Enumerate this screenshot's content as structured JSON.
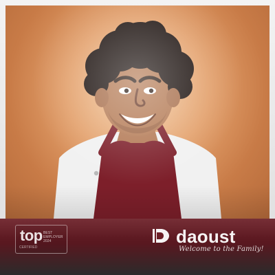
{
  "hero": {
    "image_label": "smiling-man-in-apron"
  },
  "badge": {
    "top_text": "top",
    "right_text": "BEST EMPLOYER 2024",
    "bottom_text": "CERTIFIED"
  },
  "brand": {
    "name": "daoust",
    "tagline": "Welcome to the Family!"
  },
  "colors": {
    "background": "#e9e9e9",
    "orange_bg": "#d98d56",
    "apron_red": "#7d1f2a",
    "band_red": "#6b1d25"
  }
}
